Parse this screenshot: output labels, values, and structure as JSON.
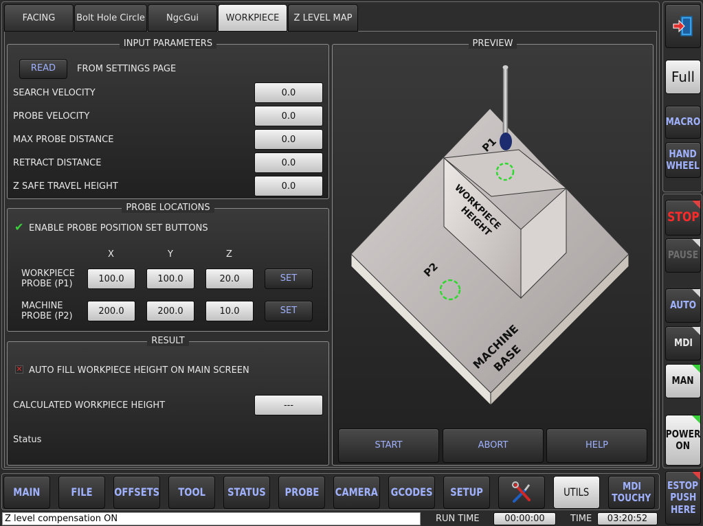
{
  "tabs": [
    "FACING",
    "Bolt Hole Circle",
    "NgcGui",
    "WORKPIECE",
    "Z LEVEL MAP"
  ],
  "input_parameters": {
    "title": "INPUT PARAMETERS",
    "read_button": "READ",
    "read_from": "FROM SETTINGS PAGE",
    "fields": [
      {
        "label": "SEARCH VELOCITY",
        "value": "0.0"
      },
      {
        "label": "PROBE VELOCITY",
        "value": "0.0"
      },
      {
        "label": "MAX PROBE DISTANCE",
        "value": "0.0"
      },
      {
        "label": "RETRACT DISTANCE",
        "value": "0.0"
      },
      {
        "label": "Z SAFE TRAVEL HEIGHT",
        "value": "0.0"
      }
    ]
  },
  "probe_locations": {
    "title": "PROBE LOCATIONS",
    "enable_label": "ENABLE PROBE POSITION SET BUTTONS",
    "enable_checked": true,
    "columns": [
      "X",
      "Y",
      "Z"
    ],
    "rows": [
      {
        "label_line1": "WORKPIECE",
        "label_line2": "PROBE (P1)",
        "x": "100.0",
        "y": "100.0",
        "z": "20.0",
        "button": "SET"
      },
      {
        "label_line1": "MACHINE",
        "label_line2": "PROBE (P2)",
        "x": "200.0",
        "y": "200.0",
        "z": "10.0",
        "button": "SET"
      }
    ]
  },
  "result": {
    "title": "RESULT",
    "autofill_label": "AUTO FILL WORKPIECE HEIGHT ON MAIN SCREEN",
    "autofill_checked": false,
    "calc_label": "CALCULATED WORKPIECE HEIGHT",
    "calc_value": "---",
    "status_label": "Status"
  },
  "preview": {
    "title": "PREVIEW",
    "p1": "P1",
    "p2": "P2",
    "workpiece_line1": "WORKPIECE",
    "workpiece_line2": "HEIGHT",
    "base_line1": "MACHINE",
    "base_line2": "BASE",
    "start": "START",
    "abort": "ABORT",
    "help": "HELP"
  },
  "side": {
    "full": "Full",
    "macro": "MACRO",
    "hand_line1": "HAND",
    "hand_line2": "WHEEL",
    "stop": "STOP",
    "pause": "PAUSE",
    "auto": "AUTO",
    "mdi": "MDI",
    "man": "MAN",
    "power_line1": "POWER",
    "power_line2": "ON",
    "estop_line1": "ESTOP",
    "estop_line2": "PUSH",
    "estop_line3": "HERE",
    "exit_icon": "exit-door-icon"
  },
  "bottom_nav": {
    "main": "MAIN",
    "file": "FILE",
    "offsets": "OFFSETS",
    "tool": "TOOL",
    "status": "STATUS",
    "probe": "PROBE",
    "camera": "CAMERA",
    "gcodes": "GCODES",
    "setup": "SETUP",
    "tools_icon": "tools-icon",
    "utils": "UTILS",
    "mdi_line1": "MDI",
    "mdi_line2": "TOUCHY"
  },
  "status_bar": {
    "message": "Z level compensation ON",
    "run_time_label": "RUN TIME",
    "run_time": "00:00:00",
    "time_label": "TIME",
    "time": "03:20:52"
  },
  "colors": {
    "accent_text": "#9fb1ff",
    "stop": "#ff2a2a",
    "check": "#3ad23a",
    "target": "#2ed82e"
  }
}
